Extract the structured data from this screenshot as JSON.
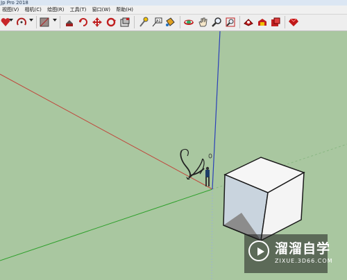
{
  "app": {
    "title_fragment": "Jp Pro 2018"
  },
  "menu": [
    "视图(V)",
    "相机(C)",
    "绘图(R)",
    "工具(T)",
    "窗口(W)",
    "帮助(H)"
  ],
  "toolbar": {
    "icons": [
      "heart-icon",
      "arc-icon",
      "rectangle-icon",
      "move-icon",
      "push-pull-icon",
      "rotate-icon",
      "follow-me-icon",
      "offset-icon",
      "tape-measure-icon",
      "text-icon",
      "paint-bucket-icon",
      "orbit-icon",
      "pan-icon",
      "zoom-icon",
      "zoom-extents-icon",
      "geo-location-icon",
      "warehouse-icon",
      "extension-warehouse-icon",
      "send-layout-icon",
      "ruby-icon"
    ]
  },
  "watermark": {
    "name": "溜溜自学",
    "url": "ZIXUE.3D66.COM"
  },
  "colors": {
    "sky_ground": "#a9c7a0",
    "red_axis": "#c0463b",
    "green_axis": "#2fa02c",
    "blue_axis": "#2a3fb8"
  }
}
